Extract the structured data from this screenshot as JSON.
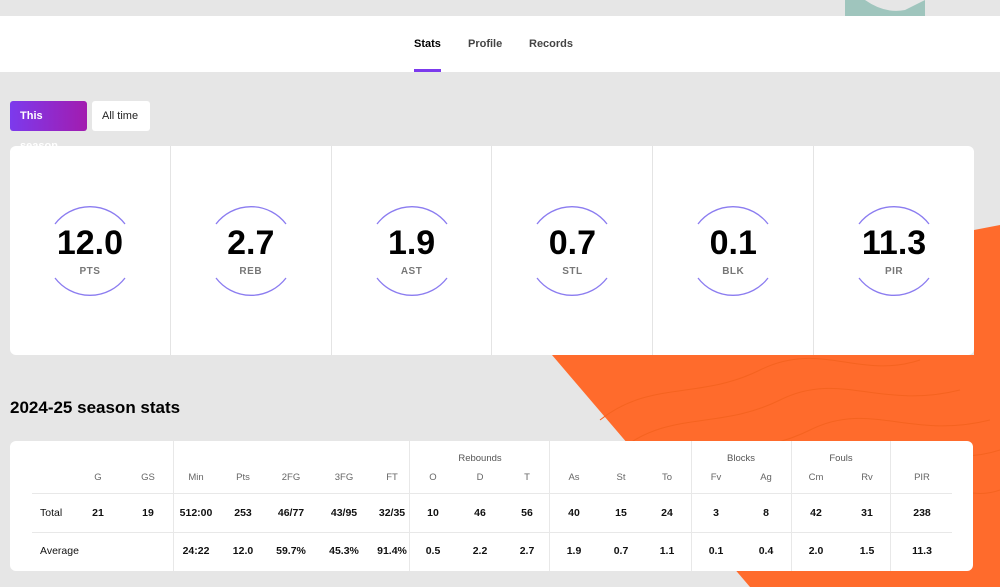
{
  "tabs": [
    {
      "label": "Stats",
      "active": true
    },
    {
      "label": "Profile",
      "active": false
    },
    {
      "label": "Records",
      "active": false
    }
  ],
  "toggle": {
    "this_season": "This season",
    "all_time": "All time"
  },
  "summary": [
    {
      "value": "12.0",
      "label": "PTS"
    },
    {
      "value": "2.7",
      "label": "REB"
    },
    {
      "value": "1.9",
      "label": "AST"
    },
    {
      "value": "0.7",
      "label": "STL"
    },
    {
      "value": "0.1",
      "label": "BLK"
    },
    {
      "value": "11.3",
      "label": "PIR"
    }
  ],
  "season_title": "2024-25 season stats",
  "table": {
    "groups": {
      "rebounds": "Rebounds",
      "blocks": "Blocks",
      "fouls": "Fouls"
    },
    "headers": [
      "G",
      "GS",
      "Min",
      "Pts",
      "2FG",
      "3FG",
      "FT",
      "O",
      "D",
      "T",
      "As",
      "St",
      "To",
      "Fv",
      "Ag",
      "Cm",
      "Rv",
      "PIR"
    ],
    "rows": [
      {
        "label": "Total",
        "values": [
          "21",
          "19",
          "512:00",
          "253",
          "46/77",
          "43/95",
          "32/35",
          "10",
          "46",
          "56",
          "40",
          "15",
          "24",
          "3",
          "8",
          "42",
          "31",
          "238"
        ]
      },
      {
        "label": "Average",
        "values": [
          "",
          "",
          "24:22",
          "12.0",
          "59.7%",
          "45.3%",
          "91.4%",
          "0.5",
          "2.2",
          "2.7",
          "1.9",
          "0.7",
          "1.1",
          "0.1",
          "0.4",
          "2.0",
          "1.5",
          "11.3"
        ]
      }
    ]
  },
  "colors": {
    "accent": "#7c3aed",
    "orange": "#ff6b2c",
    "bg": "#e6e6e6"
  }
}
